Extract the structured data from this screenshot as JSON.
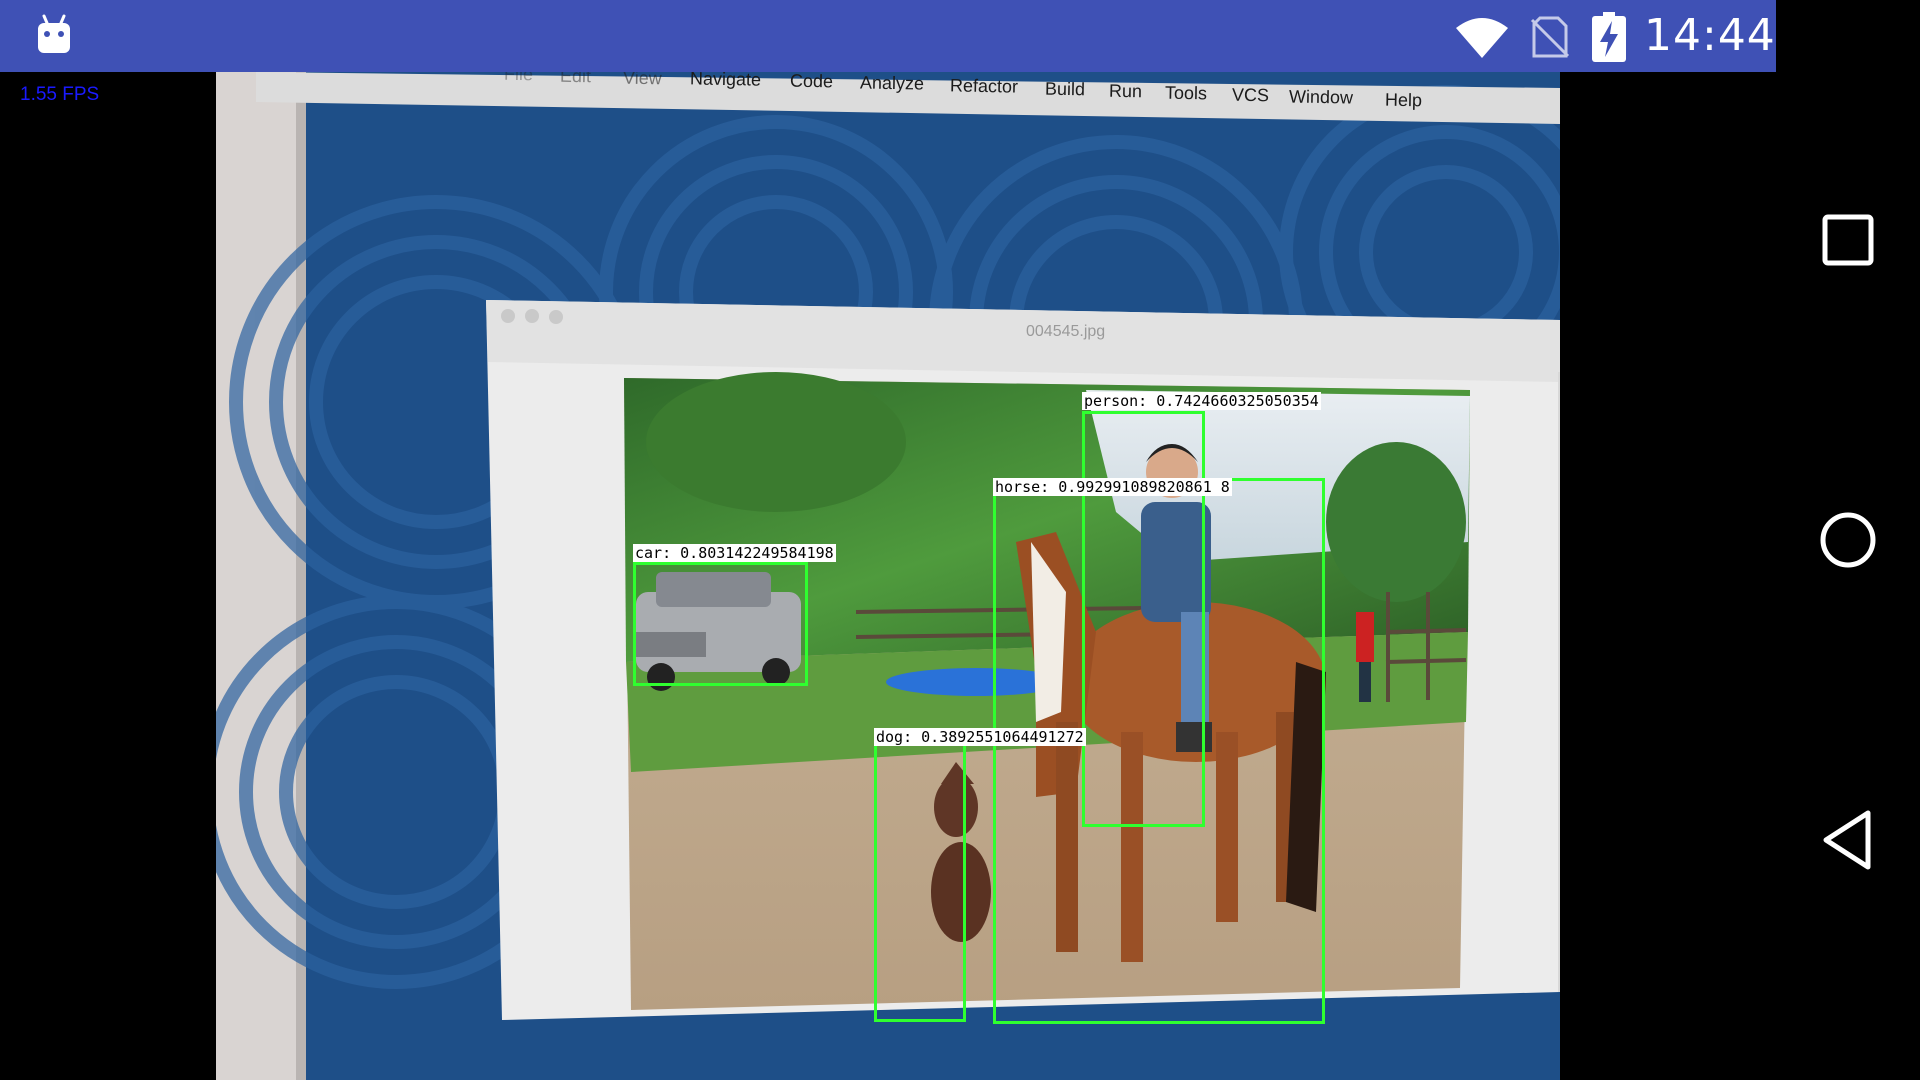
{
  "status_bar": {
    "time": "14:44",
    "background_color": "#3F51B5",
    "icons": [
      "android-debug-icon",
      "wifi-icon",
      "no-sim-icon",
      "battery-charging-icon"
    ]
  },
  "overlay": {
    "fps_text": "1.55 FPS",
    "fps_color": "#1A1AFF",
    "bbox_color": "#2FFF2F"
  },
  "viewfinder": {
    "menu": [
      "File",
      "Edit",
      "View",
      "Navigate",
      "Code",
      "Analyze",
      "Refactor",
      "Build",
      "Run",
      "Tools",
      "VCS",
      "Window",
      "Help"
    ],
    "preview_window_title": "004545.jpg"
  },
  "detections": [
    {
      "label": "car: 0.803142249584198",
      "class": "car",
      "score": 0.803142249584198
    },
    {
      "label": "person: 0.7424660325050354",
      "class": "person",
      "score": 0.7424660325050354
    },
    {
      "label": "horse: 0.992991089820861 8",
      "class": "horse",
      "score": 0.9929910898208618
    },
    {
      "label": "dog: 0.3892551064491272",
      "class": "dog",
      "score": 0.3892551064491272
    }
  ],
  "nav_bar": {
    "buttons": [
      "recents-button",
      "home-button",
      "back-button"
    ]
  }
}
